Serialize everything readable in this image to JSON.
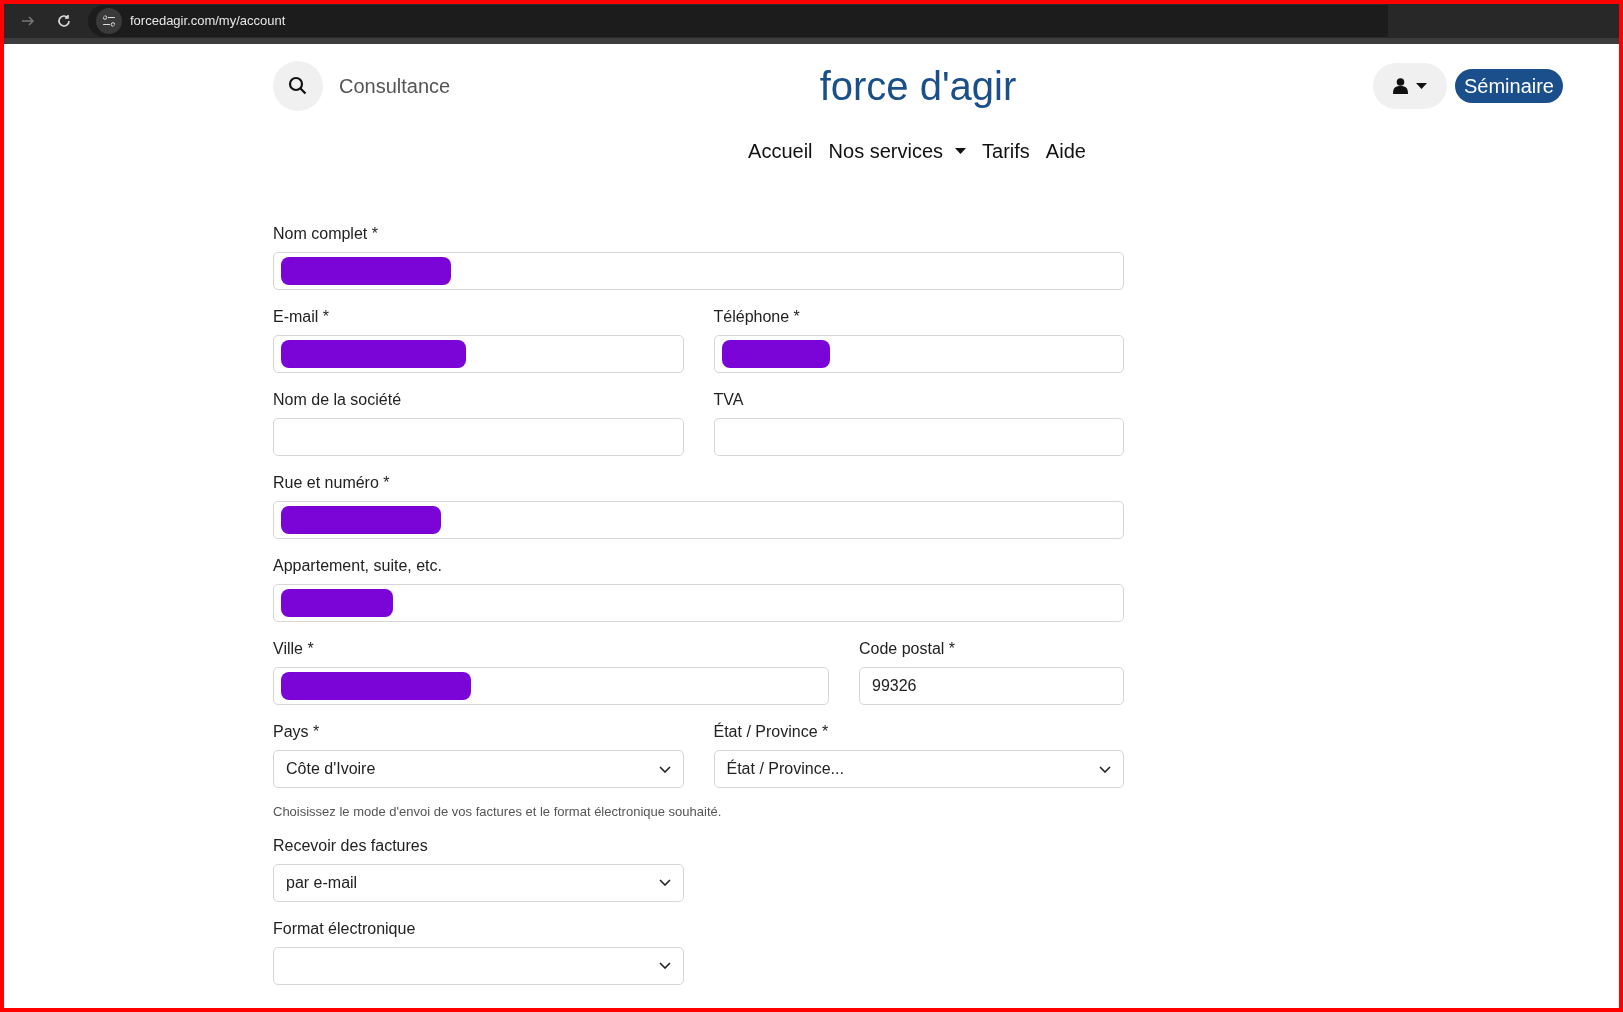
{
  "browser": {
    "url": "forcedagir.com/my/account"
  },
  "header": {
    "search_label": "Consultance",
    "title": "force d'agir",
    "button": "Séminaire"
  },
  "nav": [
    {
      "label": "Accueil",
      "dropdown": false
    },
    {
      "label": "Nos services",
      "dropdown": true
    },
    {
      "label": "Tarifs",
      "dropdown": false
    },
    {
      "label": "Aide",
      "dropdown": false
    }
  ],
  "form": [
    {
      "kind": "row",
      "fields": [
        {
          "kind": "text",
          "label": "Nom complet *",
          "redacted": true
        }
      ]
    },
    {
      "kind": "row",
      "fields": [
        {
          "kind": "text",
          "label": "E-mail *",
          "redacted": true
        },
        {
          "kind": "text",
          "label": "Téléphone *",
          "redacted": true
        }
      ]
    },
    {
      "kind": "row",
      "fields": [
        {
          "kind": "text",
          "label": "Nom de la société",
          "redacted": false
        },
        {
          "kind": "text",
          "label": "TVA",
          "redacted": false
        }
      ]
    },
    {
      "kind": "row",
      "fields": [
        {
          "kind": "text",
          "label": "Rue et numéro *",
          "redacted": true
        }
      ]
    },
    {
      "kind": "row",
      "fields": [
        {
          "kind": "text",
          "label": "Appartement, suite, etc.",
          "redacted": true
        }
      ]
    },
    {
      "kind": "row",
      "fields": [
        {
          "kind": "text",
          "label": "Ville *",
          "redacted": true
        },
        {
          "kind": "text",
          "label": "Code postal *",
          "value": "99326",
          "redacted": false
        }
      ]
    },
    {
      "kind": "row",
      "fields": [
        {
          "kind": "select",
          "label": "Pays *",
          "value": "Côte d'Ivoire"
        },
        {
          "kind": "select",
          "label": "État / Province *",
          "value": "État / Province..."
        }
      ]
    },
    {
      "kind": "hint",
      "text": "Choisissez le mode d'envoi de vos factures et le format électronique souhaité."
    },
    {
      "kind": "row",
      "fields": [
        {
          "kind": "select",
          "label": "Recevoir des factures",
          "value": "par e-mail"
        }
      ]
    },
    {
      "kind": "row",
      "fields": [
        {
          "kind": "select",
          "label": "Format électronique"
        }
      ]
    }
  ]
}
